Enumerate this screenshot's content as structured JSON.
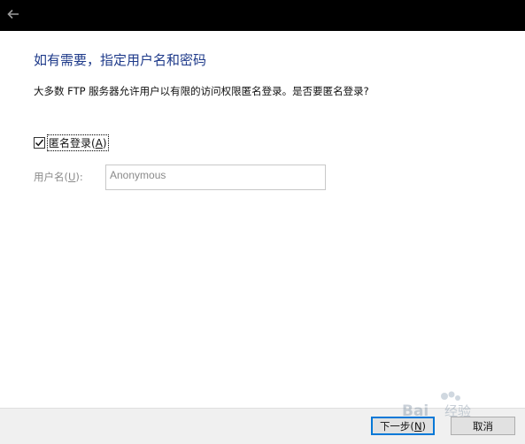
{
  "titlebar": {
    "back_icon": "arrow-left-icon"
  },
  "heading": "如有需要，指定用户名和密码",
  "description": "大多数 FTP 服务器允许用户以有限的访问权限匿名登录。是否要匿名登录?",
  "anonymous": {
    "label_prefix": "匿名登录(",
    "label_key": "A",
    "label_suffix": ")",
    "checked": true
  },
  "username": {
    "label_prefix": "用户名(",
    "label_key": "U",
    "label_suffix": "):",
    "value": "Anonymous"
  },
  "buttons": {
    "next_prefix": "下一步(",
    "next_key": "N",
    "next_suffix": ")",
    "cancel": "取消"
  },
  "colors": {
    "heading": "#1e3a8a",
    "titlebar": "#000000",
    "accent": "#0078d7"
  },
  "watermark": {
    "text": "Baidu 经验"
  }
}
